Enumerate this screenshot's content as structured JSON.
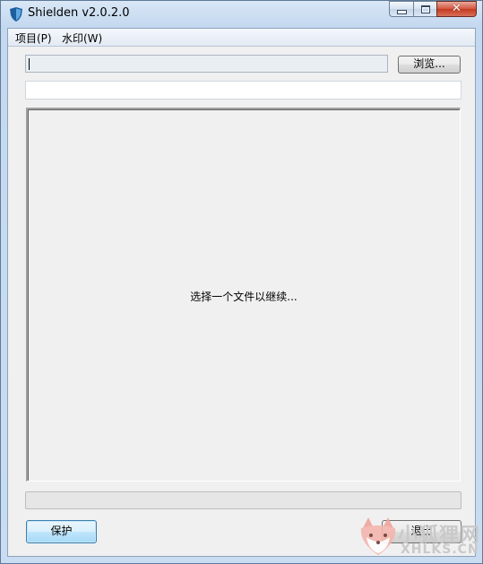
{
  "window": {
    "title": "Shielden v2.0.2.0",
    "app_icon": "shield-icon",
    "controls": {
      "minimize": "minimize-icon",
      "maximize": "maximize-icon",
      "close": "close-icon",
      "close_glyph": "✕"
    }
  },
  "menu": {
    "items": [
      {
        "label": "项目(P)"
      },
      {
        "label": "水印(W)"
      }
    ]
  },
  "file_path": {
    "value": ""
  },
  "browse_button": {
    "label": "浏览..."
  },
  "info_field": {
    "value": ""
  },
  "preview": {
    "message": "选择一个文件以继续..."
  },
  "progress": {
    "fraction": 0
  },
  "buttons": {
    "protect": "保护",
    "exit": "退出"
  },
  "overlay_watermark": {
    "text_cn": "小狐狸网",
    "text_en": "XHLKS.CN"
  },
  "colors": {
    "title_gradient_top": "#d9e7f6",
    "client_background": "#f0f0f0",
    "close_button_red": "#c33a1f",
    "default_button_blue": "#a7d9f5"
  }
}
